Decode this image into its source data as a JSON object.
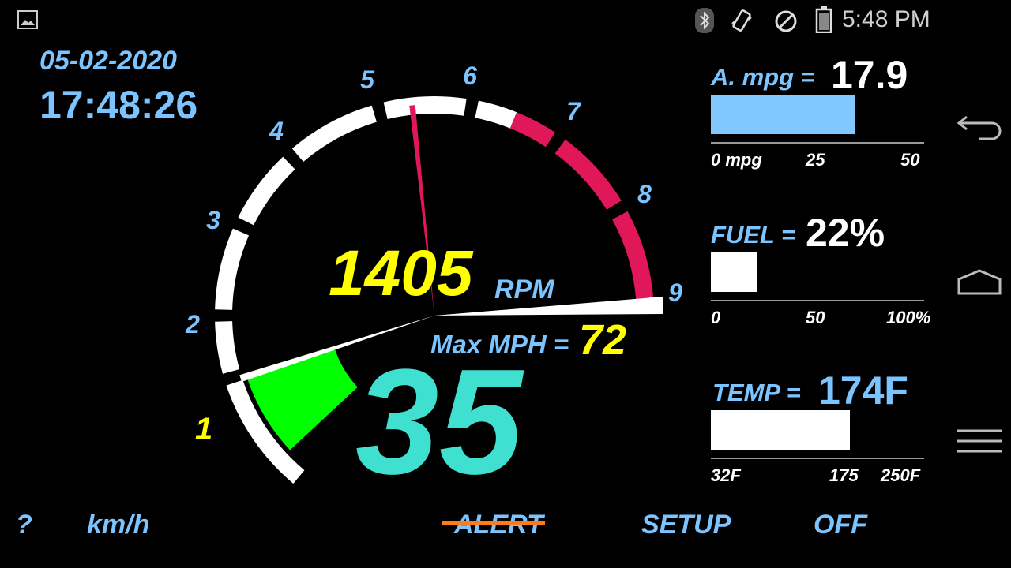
{
  "status_bar": {
    "time": "5:48 PM",
    "icons": [
      "image-icon",
      "bluetooth-icon",
      "vibrate-icon",
      "do-not-disturb-icon",
      "battery-icon"
    ]
  },
  "datetime": {
    "date": "05-02-2020",
    "time": "17:48:26"
  },
  "gauge": {
    "rpm_value": "1405",
    "rpm_unit": "RPM",
    "max_mph_label": "Max MPH =",
    "max_mph_value": "72",
    "speed": "35",
    "scale_labels": [
      "1",
      "2",
      "3",
      "4",
      "5",
      "6",
      "7",
      "8",
      "9"
    ],
    "rpm_needle_thousands": 1.4,
    "speed_fraction": 0.35,
    "colors": {
      "ring": "#ffffff",
      "redline": "#e0185a",
      "speed_fill": "#00ff00",
      "accent_label": "#7cc4ff",
      "active_label": "#ffff00"
    }
  },
  "panels": {
    "mpg": {
      "label": "A. mpg =",
      "value": "17.9",
      "fraction": 0.72,
      "ticks": [
        "0 mpg",
        "25",
        "50"
      ],
      "color": "#80c8ff"
    },
    "fuel": {
      "label": "FUEL =",
      "value": "22%",
      "fraction": 0.22,
      "ticks": [
        "0",
        "50",
        "100%"
      ],
      "color": "#ffffff"
    },
    "temp": {
      "label": "TEMP =",
      "value": "174F",
      "fraction": 0.65,
      "ticks": [
        "32F",
        "175",
        "250F"
      ],
      "color": "#ffffff"
    }
  },
  "bottom_bar": {
    "help": "?",
    "units": "km/h",
    "alert": "ALERT",
    "setup": "SETUP",
    "off": "OFF"
  },
  "nav": [
    "back-icon",
    "home-icon",
    "recents-icon"
  ]
}
